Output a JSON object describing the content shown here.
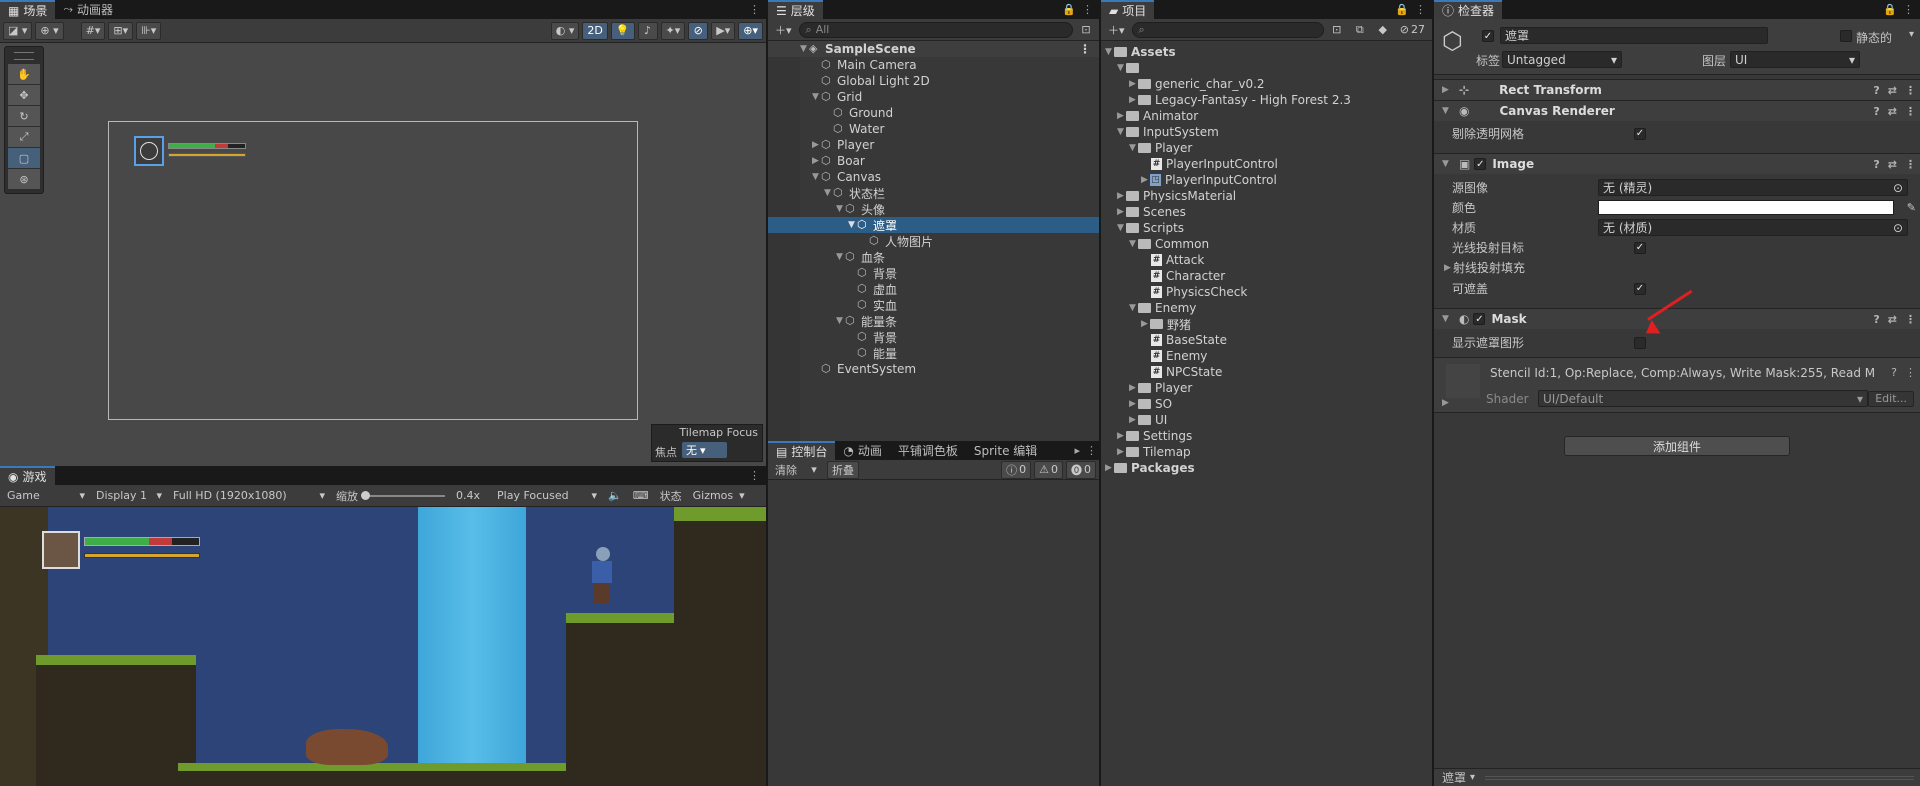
{
  "scene": {
    "tabs": [
      "场景",
      "动画器"
    ],
    "btn_2d": "2D",
    "tilemap_focus": {
      "title": "Tilemap Focus",
      "focus_label": "焦点",
      "focus_value": "无"
    }
  },
  "game": {
    "tab": "游戏",
    "mode": "Game",
    "display": "Display 1",
    "resolution": "Full HD (1920x1080)",
    "scale_label": "缩放",
    "scale_value": "0.4x",
    "play_mode": "Play Focused",
    "stats": "状态",
    "gizmos": "Gizmos"
  },
  "hierarchy": {
    "tab": "层级",
    "search_placeholder": "All",
    "items": [
      {
        "label": "SampleScene"
      },
      {
        "label": "Main Camera"
      },
      {
        "label": "Global Light 2D"
      },
      {
        "label": "Grid"
      },
      {
        "label": "Ground"
      },
      {
        "label": "Water"
      },
      {
        "label": "Player"
      },
      {
        "label": "Boar"
      },
      {
        "label": "Canvas"
      },
      {
        "label": "状态栏"
      },
      {
        "label": "头像"
      },
      {
        "label": "遮罩"
      },
      {
        "label": "人物图片"
      },
      {
        "label": "血条"
      },
      {
        "label": "背景"
      },
      {
        "label": "虚血"
      },
      {
        "label": "实血"
      },
      {
        "label": "能量条"
      },
      {
        "label": "背景"
      },
      {
        "label": "能量"
      },
      {
        "label": "EventSystem"
      }
    ]
  },
  "console": {
    "tabs": [
      "控制台",
      "动画",
      "平铺调色板",
      "Sprite 编辑"
    ],
    "clear": "清除",
    "collapse": "折叠",
    "counts": [
      "0",
      "0",
      "0"
    ]
  },
  "project": {
    "tab": "项目",
    "hidden_count": "27",
    "items": [
      {
        "label": "Assets"
      },
      {
        "label": ""
      },
      {
        "label": "generic_char_v0.2"
      },
      {
        "label": "Legacy-Fantasy - High Forest 2.3"
      },
      {
        "label": "Animator"
      },
      {
        "label": "InputSystem"
      },
      {
        "label": "Player"
      },
      {
        "label": "PlayerInputControl"
      },
      {
        "label": "PlayerInputControl"
      },
      {
        "label": "PhysicsMaterial"
      },
      {
        "label": "Scenes"
      },
      {
        "label": "Scripts"
      },
      {
        "label": "Common"
      },
      {
        "label": "Attack"
      },
      {
        "label": "Character"
      },
      {
        "label": "PhysicsCheck"
      },
      {
        "label": "Enemy"
      },
      {
        "label": "野猪"
      },
      {
        "label": "BaseState"
      },
      {
        "label": "Enemy"
      },
      {
        "label": "NPCState"
      },
      {
        "label": "Player"
      },
      {
        "label": "SO"
      },
      {
        "label": "UI"
      },
      {
        "label": "Settings"
      },
      {
        "label": "Tilemap"
      },
      {
        "label": "Packages"
      }
    ]
  },
  "inspector": {
    "tab": "检查器",
    "object_name": "遮罩",
    "static_label": "静态的",
    "tag_label": "标签",
    "tag_value": "Untagged",
    "layer_label": "图层",
    "layer_value": "UI",
    "components": {
      "rect_transform": "Rect Transform",
      "canvas_renderer": "Canvas Renderer",
      "cull_transparent": "剔除透明网格",
      "image": "Image",
      "source_image_label": "源图像",
      "source_image_value": "无 (精灵)",
      "color_label": "颜色",
      "material_label": "材质",
      "material_value": "无 (材质)",
      "raycast_target": "光线投射目标",
      "raycast_padding": "射线投射填充",
      "maskable": "可遮盖",
      "mask": "Mask",
      "show_mask_graphic": "显示遮罩图形",
      "stencil_info": "Stencil Id:1, Op:Replace, Comp:Always, Write Mask:255, Read M",
      "shader_label": "Shader",
      "shader_value": "UI/Default",
      "edit": "Edit..."
    },
    "add_component": "添加组件",
    "footer_label": "遮罩"
  },
  "colors": {
    "accent": "#2c5d87",
    "panel": "#383838",
    "health_green": "#3fae48",
    "health_red": "#c23b3b",
    "energy": "#d6a42a"
  }
}
